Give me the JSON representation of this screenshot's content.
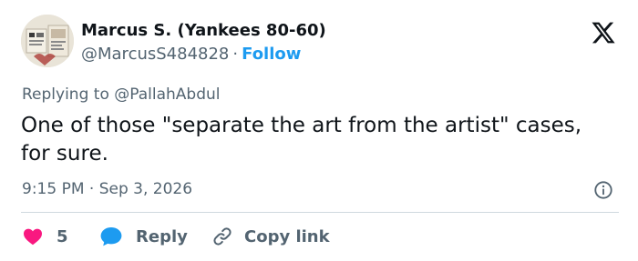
{
  "author": {
    "display_name": "Marcus S. (Yankees 80-60)",
    "handle": "@MarcusS484828",
    "separator": "·",
    "follow_label": "Follow"
  },
  "reply_context": {
    "prefix": "Replying to",
    "mention": "@PallahAbdul"
  },
  "tweet": {
    "text": "One of those \"separate the art from the artist\" cases, for sure."
  },
  "meta": {
    "time": "9:15 PM",
    "separator": "·",
    "date": "Sep 3, 2026"
  },
  "actions": {
    "like_count": "5",
    "reply_label": "Reply",
    "copy_label": "Copy link"
  },
  "icons": {
    "brand": "x-logo-icon",
    "info": "info-icon",
    "like": "heart-icon",
    "reply": "reply-bubble-icon",
    "copy": "link-icon"
  },
  "colors": {
    "text_primary": "#0f1419",
    "text_secondary": "#536471",
    "accent": "#1d9bf0",
    "like": "#f91880",
    "divider": "#cfd9de"
  }
}
